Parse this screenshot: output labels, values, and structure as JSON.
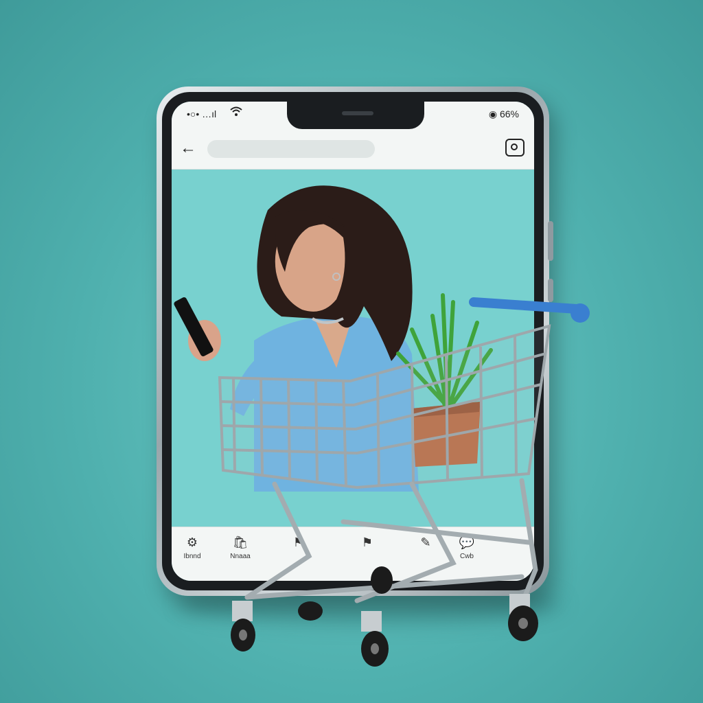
{
  "colors": {
    "background": "#4fb0ae",
    "screen_background": "#78d1cf",
    "cart_handle": "#3a7fd0",
    "sweater": "#6fb3e0",
    "hair": "#2b1c18",
    "plant": "#3fa33a",
    "pot": "#b8704a"
  },
  "phone": {
    "status_bar": {
      "left_text": "•○• …ıl",
      "wifi_icon": "wifi-icon",
      "right_text": "◉ 66%"
    },
    "app_bar": {
      "back_icon": "back-arrow-icon",
      "camera_icon": "camera-icon"
    },
    "tab_bar": {
      "tabs": [
        {
          "icon": "gear-icon",
          "label": "Ibnnd"
        },
        {
          "icon": "bag-icon",
          "label": "Nnaaa"
        },
        {
          "icon": "flag-icon",
          "label": ""
        },
        {
          "icon": "flag-icon",
          "label": ""
        },
        {
          "icon": "edit-icon",
          "label": ""
        },
        {
          "icon": "chat-icon",
          "label": "Cwb"
        }
      ]
    }
  },
  "illustration": {
    "person": "woman-looking-at-phone",
    "object": "shopping-cart",
    "cart_item": "potted-plant"
  }
}
